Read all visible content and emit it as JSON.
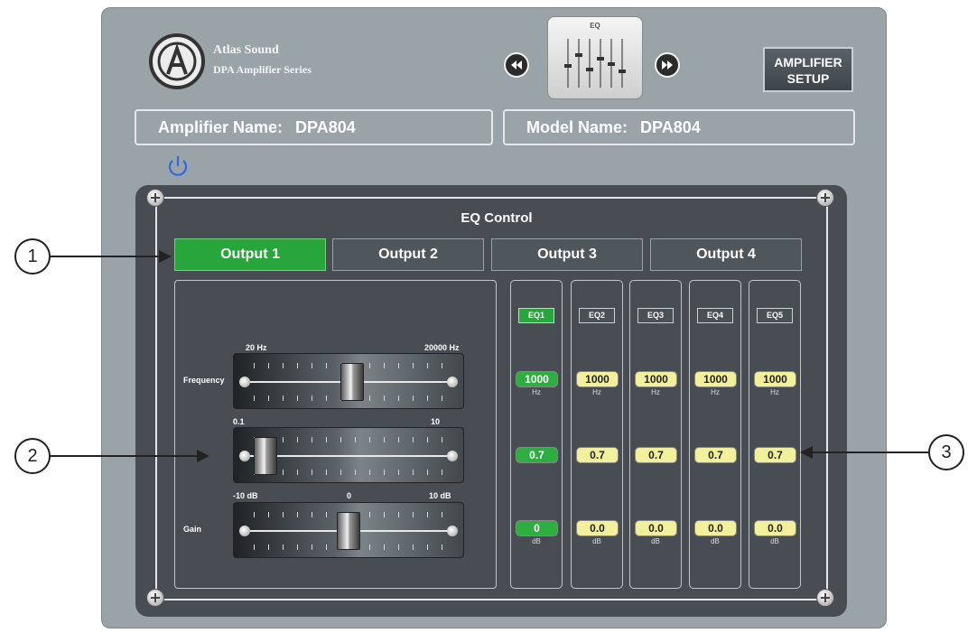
{
  "brand": {
    "line1": "Atlas Sound",
    "line2": "DPA Amplifier Series"
  },
  "nav": {
    "eq_thumb_label": "EQ",
    "setup_line1": "AMPLIFIER",
    "setup_line2": "SETUP"
  },
  "info": {
    "amp_label": "Amplifier Name:",
    "amp_value": "DPA804",
    "model_label": "Model Name:",
    "model_value": "DPA804"
  },
  "eq": {
    "title": "EQ Control",
    "tabs": [
      "Output 1",
      "Output 2",
      "Output 3",
      "Output 4"
    ],
    "sliders": {
      "frequency": {
        "label": "Frequency",
        "min": "20 Hz",
        "max": "20000 Hz"
      },
      "q": {
        "min": "0.1",
        "max": "10"
      },
      "gain": {
        "label": "Gain",
        "min": "-10 dB",
        "mid": "0",
        "max": "10 dB"
      }
    },
    "bands": [
      {
        "name": "EQ1",
        "freq": "1000",
        "freq_unit": "Hz",
        "q": "0.7",
        "gain": "0",
        "gain_unit": "dB"
      },
      {
        "name": "EQ2",
        "freq": "1000",
        "freq_unit": "Hz",
        "q": "0.7",
        "gain": "0.0",
        "gain_unit": "dB"
      },
      {
        "name": "EQ3",
        "freq": "1000",
        "freq_unit": "Hz",
        "q": "0.7",
        "gain": "0.0",
        "gain_unit": "dB"
      },
      {
        "name": "EQ4",
        "freq": "1000",
        "freq_unit": "Hz",
        "q": "0.7",
        "gain": "0.0",
        "gain_unit": "dB"
      },
      {
        "name": "EQ5",
        "freq": "1000",
        "freq_unit": "Hz",
        "q": "0.7",
        "gain": "0.0",
        "gain_unit": "dB"
      }
    ]
  },
  "callouts": [
    "1",
    "2",
    "3"
  ],
  "colors": {
    "active_green": "#28a53b",
    "value_yellow": "#f2f09a",
    "panel": "#474d52",
    "frame": "#9aa3a8"
  }
}
